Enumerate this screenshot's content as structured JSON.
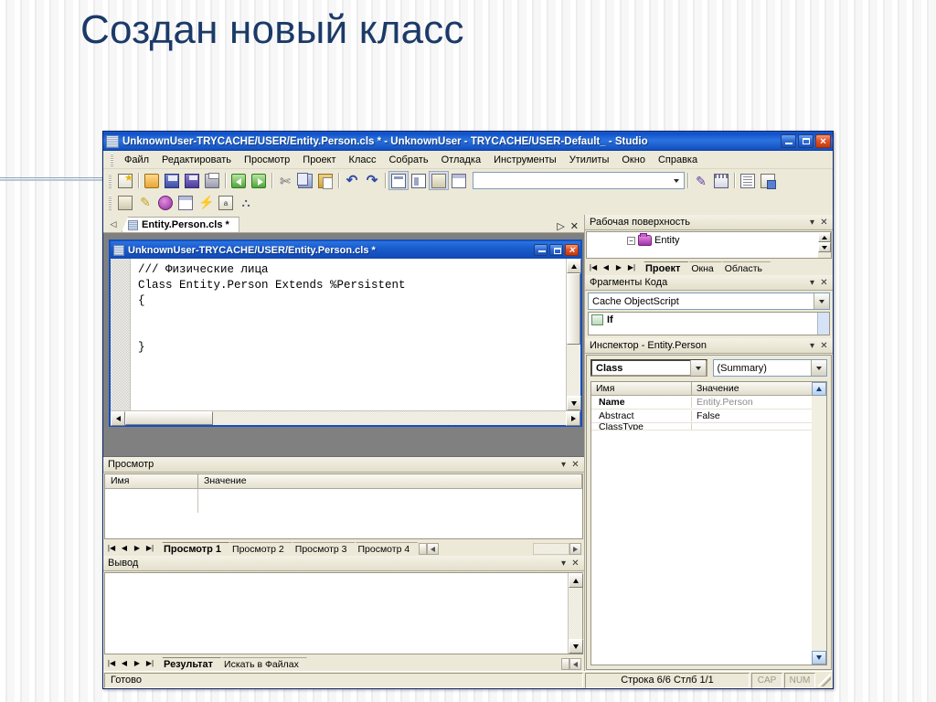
{
  "slide": {
    "title": "Создан новый класс"
  },
  "window": {
    "title": "UnknownUser-TRYCACHE/USER/Entity.Person.cls * - UnknownUser - TRYCACHE/USER-Default_ - Studio",
    "icon": "studio-icon",
    "buttons": {
      "minimize": "minimize-button",
      "maximize": "maximize-button",
      "close": "close-button"
    }
  },
  "menubar": {
    "items": [
      {
        "label": "Файл"
      },
      {
        "label": "Редактировать"
      },
      {
        "label": "Просмотр"
      },
      {
        "label": "Проект"
      },
      {
        "label": "Класс"
      },
      {
        "label": "Собрать"
      },
      {
        "label": "Отладка"
      },
      {
        "label": "Инструменты"
      },
      {
        "label": "Утилиты"
      },
      {
        "label": "Окно"
      },
      {
        "label": "Справка"
      }
    ]
  },
  "toolbar_main": {
    "buttons": [
      {
        "name": "new-document-icon",
        "kind": "wiz"
      },
      {
        "name": "open-folder-icon",
        "kind": "folder"
      },
      {
        "name": "save-icon",
        "kind": "save"
      },
      {
        "name": "save-all-icon",
        "kind": "saveall"
      },
      {
        "name": "print-icon",
        "kind": "print"
      },
      {
        "name": "back-icon",
        "kind": "back"
      },
      {
        "name": "forward-icon",
        "kind": "fwd"
      },
      {
        "name": "cut-icon",
        "kind": "cut"
      },
      {
        "name": "copy-icon",
        "kind": "copy"
      },
      {
        "name": "paste-icon",
        "kind": "paste"
      },
      {
        "name": "undo-icon",
        "kind": "undo"
      },
      {
        "name": "redo-icon",
        "kind": "redo"
      },
      {
        "name": "view-class-icon",
        "kind": "panel"
      },
      {
        "name": "view-inspector-icon",
        "kind": "panel2"
      },
      {
        "name": "view-workspace-icon",
        "kind": "gen"
      },
      {
        "name": "view-output-icon",
        "kind": "win"
      }
    ],
    "search_combo": {
      "value": "",
      "placeholder": ""
    },
    "right_buttons": [
      {
        "name": "debug-icon",
        "kind": "dbg"
      },
      {
        "name": "calendar-icon",
        "kind": "cal"
      },
      {
        "name": "list-icon",
        "kind": "list"
      },
      {
        "name": "macro-icon",
        "kind": "mac"
      }
    ]
  },
  "toolbar_secondary": {
    "buttons": [
      {
        "name": "new-class-icon",
        "kind": "gen"
      },
      {
        "name": "new-property-icon",
        "kind": "bolt"
      },
      {
        "name": "new-method-icon",
        "kind": "purple"
      },
      {
        "name": "new-window-icon",
        "kind": "win"
      },
      {
        "name": "new-trigger-icon",
        "kind": "bolt"
      },
      {
        "name": "new-parameter-icon",
        "kind": "ab"
      },
      {
        "name": "class-hierarchy-icon",
        "kind": "tree"
      }
    ]
  },
  "doctabs": {
    "nav_icon": "tab-scroll-left-icon",
    "tabs": [
      {
        "label": "Entity.Person.cls *",
        "icon": "class-file-icon",
        "active": true
      }
    ],
    "right_controls": [
      {
        "name": "tab-scroll-right-icon",
        "glyph": "▷"
      },
      {
        "name": "close-tab-icon",
        "glyph": "✕"
      }
    ]
  },
  "editor_window": {
    "title": "UnknownUser-TRYCACHE/USER/Entity.Person.cls *",
    "icon": "class-file-icon",
    "buttons": {
      "minimize": "minimize-button",
      "maximize": "maximize-button",
      "close": "close-button"
    },
    "code": "/// Физические лица\nClass Entity.Person Extends %Persistent\n{\n\n\n}"
  },
  "workspace_panel": {
    "title": "Рабочая поверхность",
    "tree": [
      {
        "label": "Entity",
        "icon": "package-icon",
        "expander": "−"
      }
    ],
    "tabs": [
      {
        "label": "Проект",
        "active": true
      },
      {
        "label": "Окна",
        "active": false
      },
      {
        "label": "Область",
        "active": false
      }
    ],
    "nav": [
      "|◀",
      "◀",
      "▶",
      "▶|"
    ]
  },
  "snippets_panel": {
    "title": "Фрагменты Кода",
    "language_combo": {
      "value": "Cache ObjectScript"
    },
    "items": [
      {
        "label": "If",
        "icon": "snippet-icon"
      }
    ]
  },
  "inspector_panel": {
    "title": "Инспектор - Entity.Person",
    "combo_left": {
      "value": "Class"
    },
    "combo_right": {
      "value": "(Summary)"
    },
    "columns": [
      "Имя",
      "Значение"
    ],
    "rows": [
      {
        "name": "Name",
        "value": "Entity.Person",
        "bold": true,
        "dim": true
      },
      {
        "name": "Abstract",
        "value": "False",
        "bold": false,
        "dim": false
      },
      {
        "name": "ClassType",
        "value": "",
        "bold": false,
        "dim": false
      }
    ]
  },
  "watch_panel": {
    "title": "Просмотр",
    "columns": [
      "Имя",
      "Значение"
    ],
    "rows": [
      {
        "name": "",
        "value": ""
      }
    ],
    "tabs": [
      {
        "label": "Просмотр 1",
        "active": true
      },
      {
        "label": "Просмотр 2",
        "active": false
      },
      {
        "label": "Просмотр 3",
        "active": false
      },
      {
        "label": "Просмотр 4",
        "active": false
      }
    ],
    "nav": [
      "|◀",
      "◀",
      "▶",
      "▶|"
    ]
  },
  "output_panel": {
    "title": "Вывод",
    "content": "",
    "tabs": [
      {
        "label": "Результат",
        "active": true
      },
      {
        "label": "Искать в Файлах",
        "active": false
      }
    ],
    "nav": [
      "|◀",
      "◀",
      "▶",
      "▶|"
    ]
  },
  "statusbar": {
    "message": "Готово",
    "position": "Строка 6/6 Стлб 1/1",
    "caps": "CAP",
    "num": "NUM"
  },
  "colors": {
    "title_blue": "#1b3a68",
    "window_border": "#0a246a",
    "titlebar_blue": "#1550c0",
    "chrome": "#ece9d8",
    "mdi_backdrop": "#808080"
  }
}
